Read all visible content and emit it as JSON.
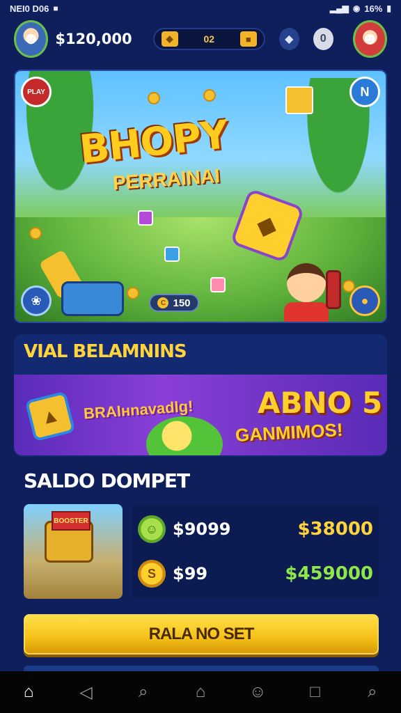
{
  "status_bar": {
    "left_text": "NEI0 D06",
    "left_icon": "notification-icon",
    "signal": "signal-icon",
    "battery_text": "16%",
    "wifi_icon": "wifi-icon"
  },
  "header": {
    "balance": "$120,000",
    "pill_value": "02",
    "left_avatar": "player-avatar-icon",
    "right_avatar": "friend-avatar-icon",
    "diamond_icon": "diamond-icon",
    "info_label": "0"
  },
  "hero": {
    "title": "BHOPY",
    "subtitle": "PERRAINAI",
    "gem_symbol": "◆",
    "badge_left": "PLAY",
    "badge_right": "N",
    "counter_value": "150",
    "counter_icon": "C",
    "btn_left_icon": "❀",
    "btn_right_icon": "●"
  },
  "promo_section": {
    "title": "VIAL BELAMNINS",
    "left_text": "BRAIнnavadlg!",
    "right_line1": "ABNO 5",
    "right_line2": "GANMIMOS!",
    "tile_symbol": "▲"
  },
  "wallet": {
    "title": "SALDO DOMPET",
    "thumb_sign": "BOOSTER",
    "rows": [
      {
        "icon": "☺",
        "label": "$9099",
        "value": "$38000"
      },
      {
        "icon": "S",
        "label": "$99",
        "value": "$459000"
      }
    ]
  },
  "cta": {
    "label": "RALA NO SET"
  },
  "bottom_nav": {
    "items": [
      "⌂",
      "◁",
      "⌕",
      "⌂",
      "☺",
      "□",
      "⌕"
    ]
  },
  "colors": {
    "background": "#0f1f5c",
    "accent_gold": "#ffd43a",
    "accent_green": "#8fe84a",
    "cta": "#f5c018"
  }
}
